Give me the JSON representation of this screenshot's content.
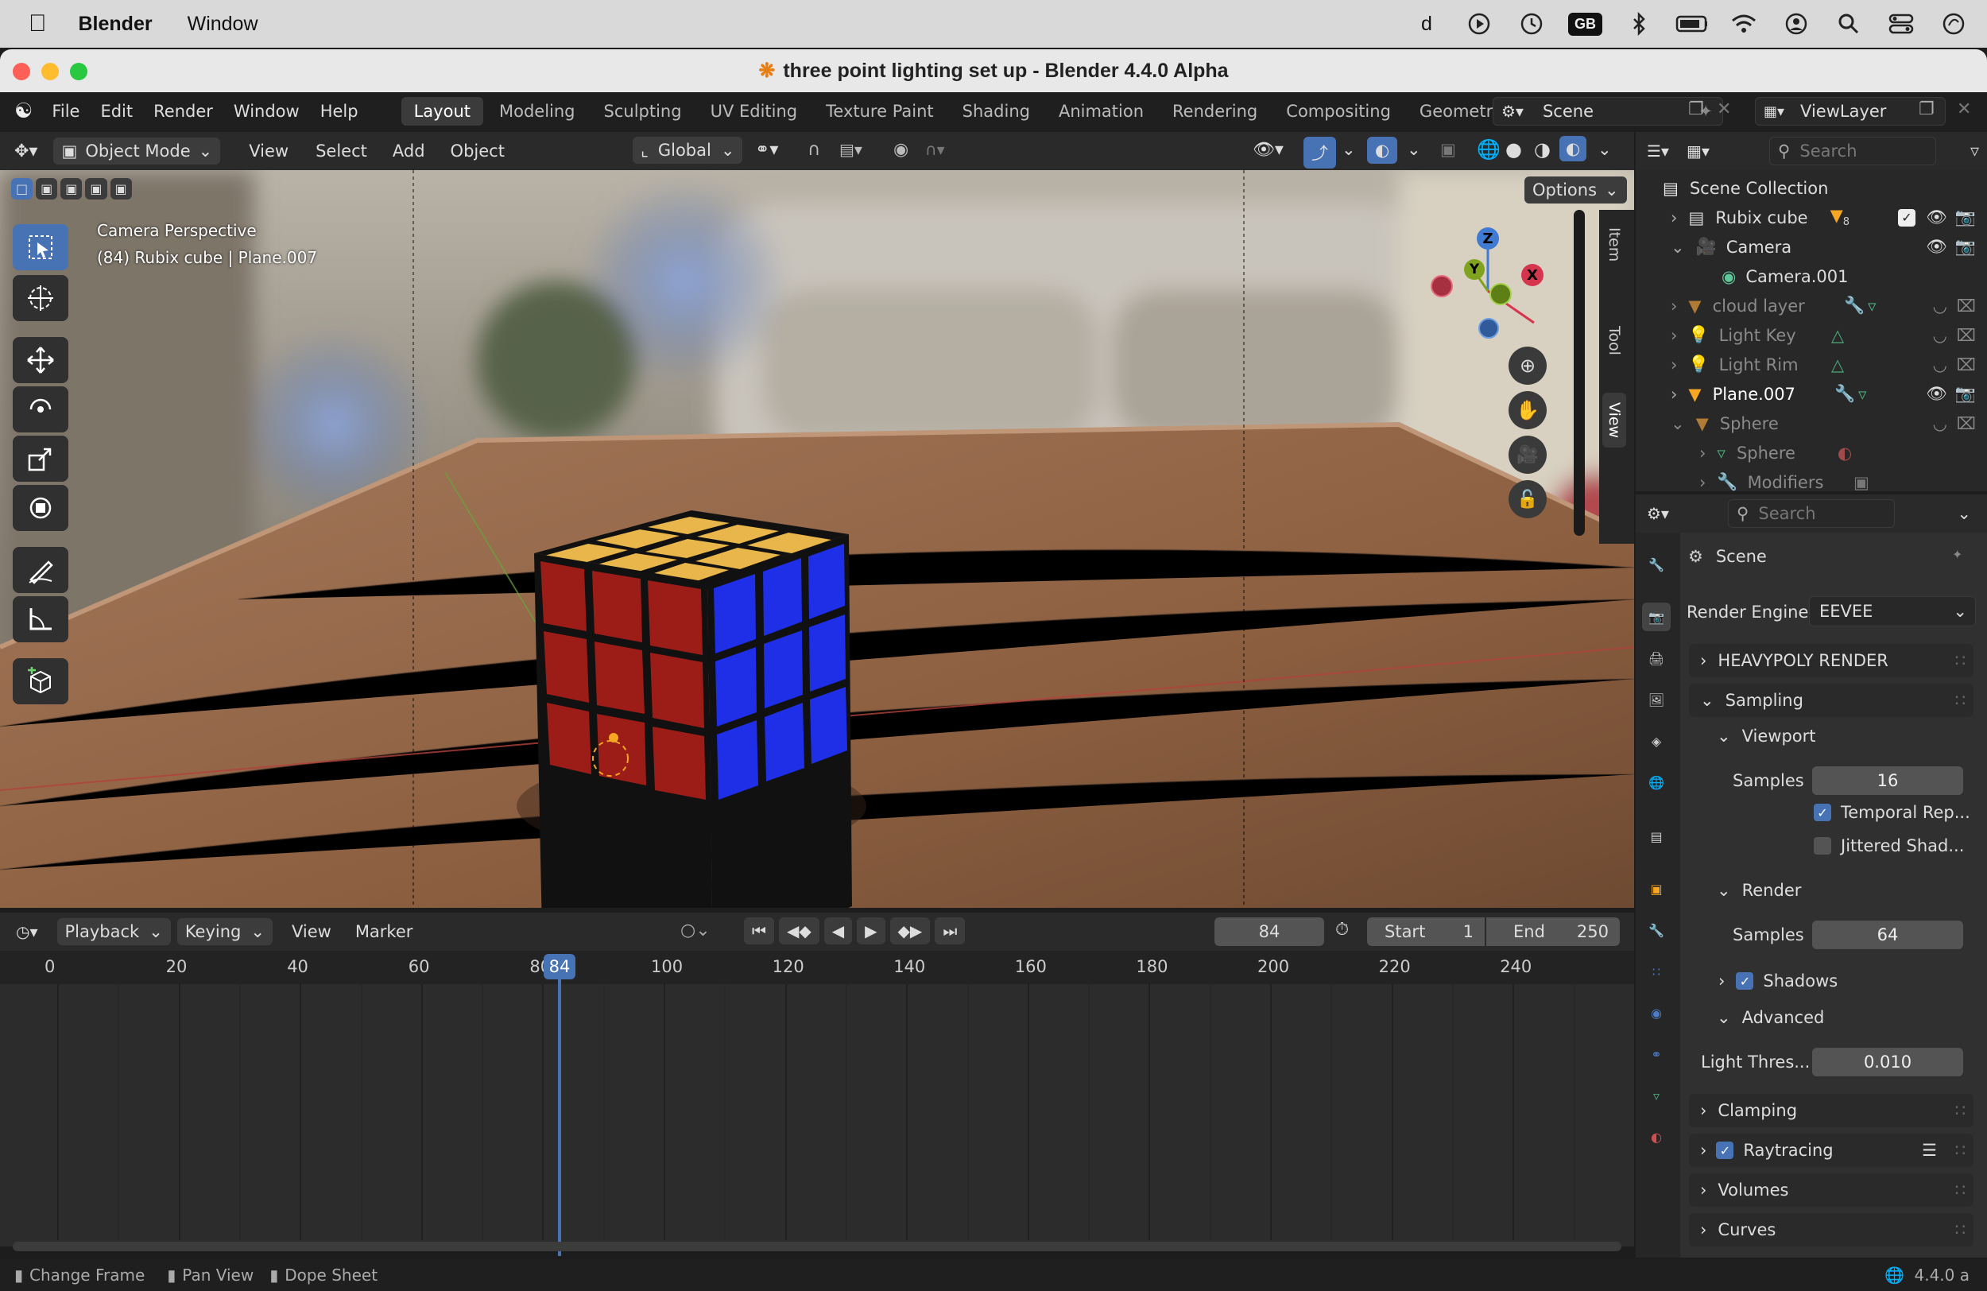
{
  "mac_menubar": {
    "app_name": "Blender",
    "menus": [
      "Window"
    ],
    "status": {
      "input_source": "d",
      "keyboard_badge": "GB"
    }
  },
  "window": {
    "title": "three point lighting set up - Blender 4.4.0 Alpha"
  },
  "topbar": {
    "menus": [
      "File",
      "Edit",
      "Render",
      "Window",
      "Help"
    ],
    "workspaces": [
      "Layout",
      "Modeling",
      "Sculpting",
      "UV Editing",
      "Texture Paint",
      "Shading",
      "Animation",
      "Rendering",
      "Compositing",
      "Geometry Nodes"
    ],
    "active_workspace": "Layout",
    "scene": "Scene",
    "view_layer": "ViewLayer"
  },
  "viewport": {
    "mode": "Object Mode",
    "menus": [
      "View",
      "Select",
      "Add",
      "Object"
    ],
    "transform_orientation": "Global",
    "options_label": "Options",
    "overlay_text_1": "Camera Perspective",
    "overlay_text_2": "(84) Rubix cube | Plane.007",
    "side_tabs": [
      "Item",
      "Tool",
      "View"
    ],
    "gizmo_axes": {
      "z": "Z",
      "y": "Y",
      "x": "X"
    }
  },
  "outliner": {
    "search_placeholder": "Search",
    "root": "Scene Collection",
    "items": [
      {
        "name": "Rubix cube",
        "badge": "8"
      },
      {
        "name": "Camera"
      },
      {
        "name": "Camera.001"
      },
      {
        "name": "cloud layer"
      },
      {
        "name": "Light Key"
      },
      {
        "name": "Light Rim"
      },
      {
        "name": "Plane.007"
      },
      {
        "name": "Sphere"
      },
      {
        "name": "Sphere"
      },
      {
        "name": "Modifiers"
      }
    ]
  },
  "properties": {
    "search_placeholder": "Search",
    "context": "Scene",
    "render_engine_label": "Render Engine",
    "render_engine": "EEVEE",
    "sections": {
      "heavypoly": "HEAVYPOLY RENDER",
      "sampling": "Sampling",
      "viewport": "Viewport",
      "viewport_samples_label": "Samples",
      "viewport_samples": "16",
      "temporal": "Temporal Rep...",
      "jittered": "Jittered Shad...",
      "render": "Render",
      "render_samples_label": "Samples",
      "render_samples": "64",
      "shadows": "Shadows",
      "advanced": "Advanced",
      "light_threshold_label": "Light Thres...",
      "light_threshold": "0.010",
      "clamping": "Clamping",
      "raytracing": "Raytracing",
      "volumes": "Volumes",
      "curves": "Curves"
    }
  },
  "timeline": {
    "menus": [
      "Playback",
      "Keying",
      "View",
      "Marker"
    ],
    "current_frame": "84",
    "start_label": "Start",
    "start": "1",
    "end_label": "End",
    "end": "250",
    "ticks": [
      "0",
      "20",
      "40",
      "60",
      "80",
      "100",
      "120",
      "140",
      "160",
      "180",
      "200",
      "220",
      "240"
    ]
  },
  "statusbar": {
    "items": [
      "Change Frame",
      "Pan View",
      "Dope Sheet"
    ],
    "version": "4.4.0 a"
  },
  "colors": {
    "accent": "#4772b3",
    "active_obj": "#f5a623",
    "axis_x": "#d6354e",
    "axis_y": "#7fa31f",
    "axis_z": "#3f7bd3"
  }
}
